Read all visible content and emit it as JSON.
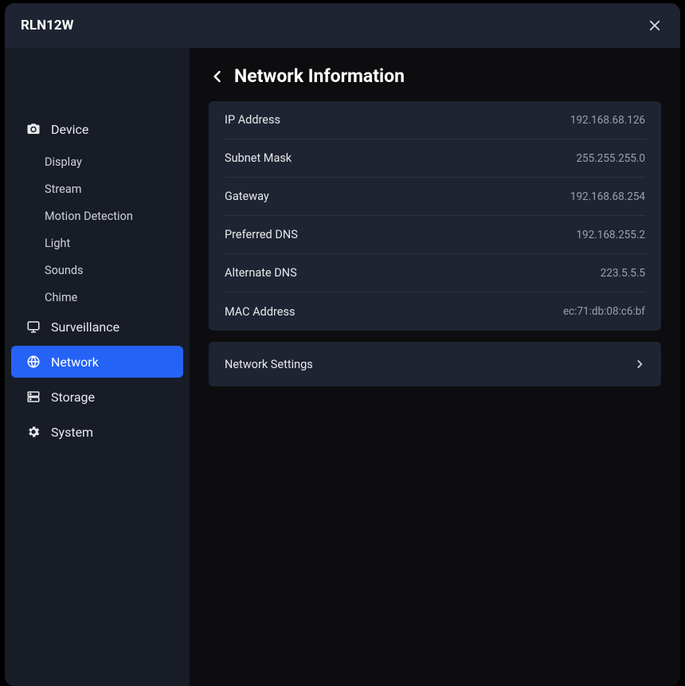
{
  "header": {
    "title": "RLN12W"
  },
  "sidebar": {
    "device": {
      "label": "Device",
      "items": [
        {
          "label": "Display"
        },
        {
          "label": "Stream"
        },
        {
          "label": "Motion Detection"
        },
        {
          "label": "Light"
        },
        {
          "label": "Sounds"
        },
        {
          "label": "Chime"
        }
      ]
    },
    "surveillance": {
      "label": "Surveillance"
    },
    "network": {
      "label": "Network"
    },
    "storage": {
      "label": "Storage"
    },
    "system": {
      "label": "System"
    }
  },
  "page": {
    "title": "Network Information",
    "rows": [
      {
        "label": "IP Address",
        "value": "192.168.68.126"
      },
      {
        "label": "Subnet Mask",
        "value": "255.255.255.0"
      },
      {
        "label": "Gateway",
        "value": "192.168.68.254"
      },
      {
        "label": "Preferred DNS",
        "value": "192.168.255.2"
      },
      {
        "label": "Alternate DNS",
        "value": "223.5.5.5"
      },
      {
        "label": "MAC Address",
        "value": "ec:71:db:08:c6:bf"
      }
    ],
    "settings_link": "Network Settings"
  }
}
